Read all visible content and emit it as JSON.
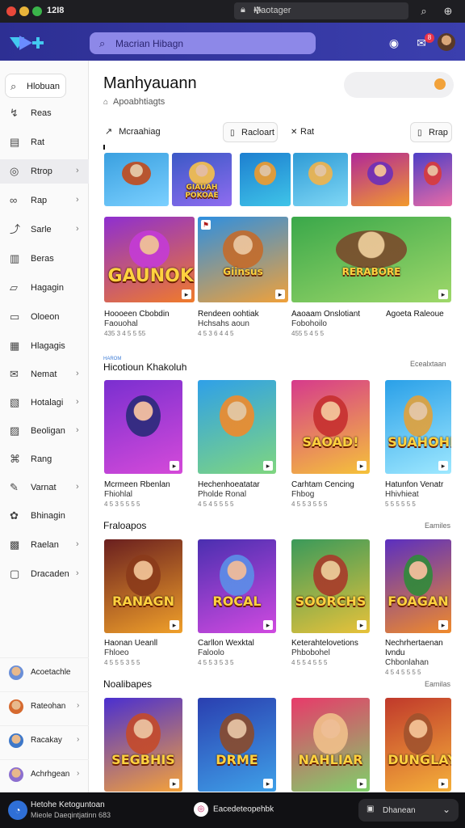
{
  "titlebar": {
    "app_name": "12I8",
    "url": "Maotager"
  },
  "appbar": {
    "search_placeholder": "Macrian Hibagn",
    "notification_count": "8"
  },
  "sidebar": {
    "home_label": "Hlobuan",
    "items": [
      {
        "label": "Reas",
        "icon": "trending-icon",
        "chevron": false
      },
      {
        "label": "Rat",
        "icon": "calendar-icon",
        "chevron": false
      },
      {
        "label": "Rtrop",
        "icon": "compass-icon",
        "chevron": true
      },
      {
        "label": "Rap",
        "icon": "link-icon",
        "chevron": true
      },
      {
        "label": "Sarle",
        "icon": "share-icon",
        "chevron": true
      },
      {
        "label": "Beras",
        "icon": "book-icon",
        "chevron": false
      },
      {
        "label": "Hagagin",
        "icon": "folder-icon",
        "chevron": false
      },
      {
        "label": "Oloeon",
        "icon": "file-icon",
        "chevron": false
      },
      {
        "label": "Hlagagis",
        "icon": "document-icon",
        "chevron": false
      },
      {
        "label": "Nemat",
        "icon": "message-icon",
        "chevron": true
      },
      {
        "label": "Hotalagi",
        "icon": "clipboard-icon",
        "chevron": true
      },
      {
        "label": "Beoligan",
        "icon": "image-icon",
        "chevron": true
      },
      {
        "label": "Rang",
        "icon": "tag-icon",
        "chevron": false
      },
      {
        "label": "Varnat",
        "icon": "puzzle-icon",
        "chevron": true
      },
      {
        "label": "Bhinagin",
        "icon": "gift-icon",
        "chevron": false
      },
      {
        "label": "Raelan",
        "icon": "grid-icon",
        "chevron": true
      },
      {
        "label": "Dracaden",
        "icon": "window-icon",
        "chevron": true
      }
    ],
    "users": [
      {
        "label": "Acoetachle",
        "color": "#6a8fd8",
        "chevron": false
      },
      {
        "label": "Rateohan",
        "color": "#d66a2f",
        "chevron": true
      },
      {
        "label": "Racakay",
        "color": "#3e78c9",
        "chevron": true
      },
      {
        "label": "Achrhgean",
        "color": "#8c6fcf",
        "chevron": true
      }
    ]
  },
  "main": {
    "title": "Manhyauann",
    "subtitle": "Apoabhtiagts",
    "tabs": [
      {
        "label": "Mcraahiag",
        "icon": "arrow-icon"
      },
      {
        "label": "Racloart",
        "icon": "page-icon"
      },
      {
        "label": "Rat",
        "icon": "x-icon"
      },
      {
        "label": "Rrap",
        "icon": "page-icon"
      }
    ],
    "strip": [
      {
        "word": "",
        "bg1": "#3aa0e0",
        "bg2": "#7bd0ff",
        "fig": "#c24a1b"
      },
      {
        "word": "GIAUAH POKOAE",
        "bg1": "#3b59c6",
        "bg2": "#8f6cf0",
        "fig": "#f7c24a"
      },
      {
        "word": "",
        "bg1": "#1d7fd0",
        "bg2": "#3fc4e8",
        "fig": "#f09b2d"
      },
      {
        "word": "",
        "bg1": "#2e9bd6",
        "bg2": "#7fd7f5",
        "fig": "#f2b34a"
      },
      {
        "word": "",
        "bg1": "#b0279a",
        "bg2": "#f29a2d",
        "fig": "#6c2fb8"
      },
      {
        "word": "",
        "bg1": "#4d3fc7",
        "bg2": "#e86aa5",
        "fig": "#d93a3a"
      }
    ],
    "featured": [
      {
        "word": "GAUNOK",
        "bg1": "#8e2fd0",
        "bg2": "#f07b2b",
        "fig": "#c43bd6",
        "l1": "Hoooeen Cbobdin",
        "l2": "Faouohal",
        "l3": "435 3 4 5 5 55"
      },
      {
        "word": "Giinsus",
        "bg1": "#2e8fe0",
        "bg2": "#f0a13a",
        "fig": "#c46b2b",
        "l1": "Rendeen oohtiak",
        "l2": "Hchsahs aoun",
        "l3": "4 5 3 6 4 4 5"
      },
      {
        "word": "RERABORE",
        "bg1": "#3aa84a",
        "bg2": "#9fd86a",
        "fig": "#7a4a2c",
        "l1": "Aaoaam Onslotiant",
        "l2": "Fobohoilo",
        "l3": "455 5 4 5 5",
        "extra": "Agoeta Raleoue"
      }
    ],
    "section1": {
      "title": "Hicotioun Khakoluh",
      "kicker": "HAROM",
      "link": "Ecealxtaan"
    },
    "row1": [
      {
        "word": "",
        "bg1": "#7a2fd0",
        "bg2": "#d54ad9",
        "fig": "#2a2a7a",
        "l1": "Mcrmeen Rbenlan",
        "l2": "Fhiohlal",
        "l3": "4 5 3 5 5 5 5"
      },
      {
        "word": "",
        "bg1": "#2fa0e8",
        "bg2": "#7fd67f",
        "fig": "#f08a2b",
        "l1": "Hechenhoeatatar",
        "l2": "Pholde Ronal",
        "l3": "4 5 4 5 5 5 5"
      },
      {
        "word": "SAOAD!",
        "bg1": "#d63a8c",
        "bg2": "#f5c23a",
        "fig": "#c62f2f",
        "l1": "Carhtam Cencing",
        "l2": "Fhbog",
        "l3": "4 5 5 3 5 5 5"
      },
      {
        "word": "SUAHOHNI",
        "bg1": "#2aa0e8",
        "bg2": "#9ee8ff",
        "fig": "#e2a13a",
        "l1": "Hatunfon Venatr",
        "l2": "Hhivhieat",
        "l3": "5 5 5 5 5 5"
      }
    ],
    "section2": {
      "title": "Fraloapos",
      "link": "Eamiles"
    },
    "row2": [
      {
        "word": "RANAGN",
        "bg1": "#6a1f1f",
        "bg2": "#f0a02a",
        "fig": "#8a3a1a",
        "l1": "Haonan Ueanll",
        "l2": "Fhloeo",
        "l3": "4 5 5 5 3 5 5"
      },
      {
        "word": "ROCAL",
        "bg1": "#4a2fb0",
        "bg2": "#d04ae0",
        "fig": "#5b8fe8",
        "l1": "Carllon Wexktal",
        "l2": "Faloolo",
        "l3": "4 5 5 3 5 3 5"
      },
      {
        "word": "SOORCHS",
        "bg1": "#3a9a5a",
        "bg2": "#e8c23a",
        "fig": "#a83a2a",
        "l1": "Keterahtelovetions",
        "l2": "Phbobohel",
        "l3": "4 5 5 4 5 5 5"
      },
      {
        "word": "FOAGAN",
        "bg1": "#5b2fc0",
        "bg2": "#f08a2b",
        "fig": "#2f8a3a",
        "l1": "Nechrhertaenan Ivndu",
        "l2": "Chbonlahan",
        "l3": "4 5 4 5 5 5 5"
      }
    ],
    "section3": {
      "title": "Noalibapes",
      "link": "Eamilas"
    },
    "row3": [
      {
        "word": "SEGBHIS",
        "bg1": "#4a2fd0",
        "bg2": "#f5a23a",
        "fig": "#c44a2a"
      },
      {
        "word": "DRME",
        "bg1": "#2a3fb0",
        "bg2": "#3fa0e8",
        "fig": "#8a4a2a"
      },
      {
        "word": "NAHLIAR",
        "bg1": "#e83a6a",
        "bg2": "#7fd06a",
        "fig": "#f0c08a"
      },
      {
        "word": "DUNGLAY",
        "bg1": "#c0392b",
        "bg2": "#f5b03a",
        "fig": "#a0522d"
      }
    ]
  },
  "bottombar": {
    "user_line1": "Hetohe Ketoguntoan",
    "user_line2": "Mieole Daeqintjatinn 683",
    "mid_label": "Eacedeteopehbk",
    "button_label": "Dhanean"
  }
}
